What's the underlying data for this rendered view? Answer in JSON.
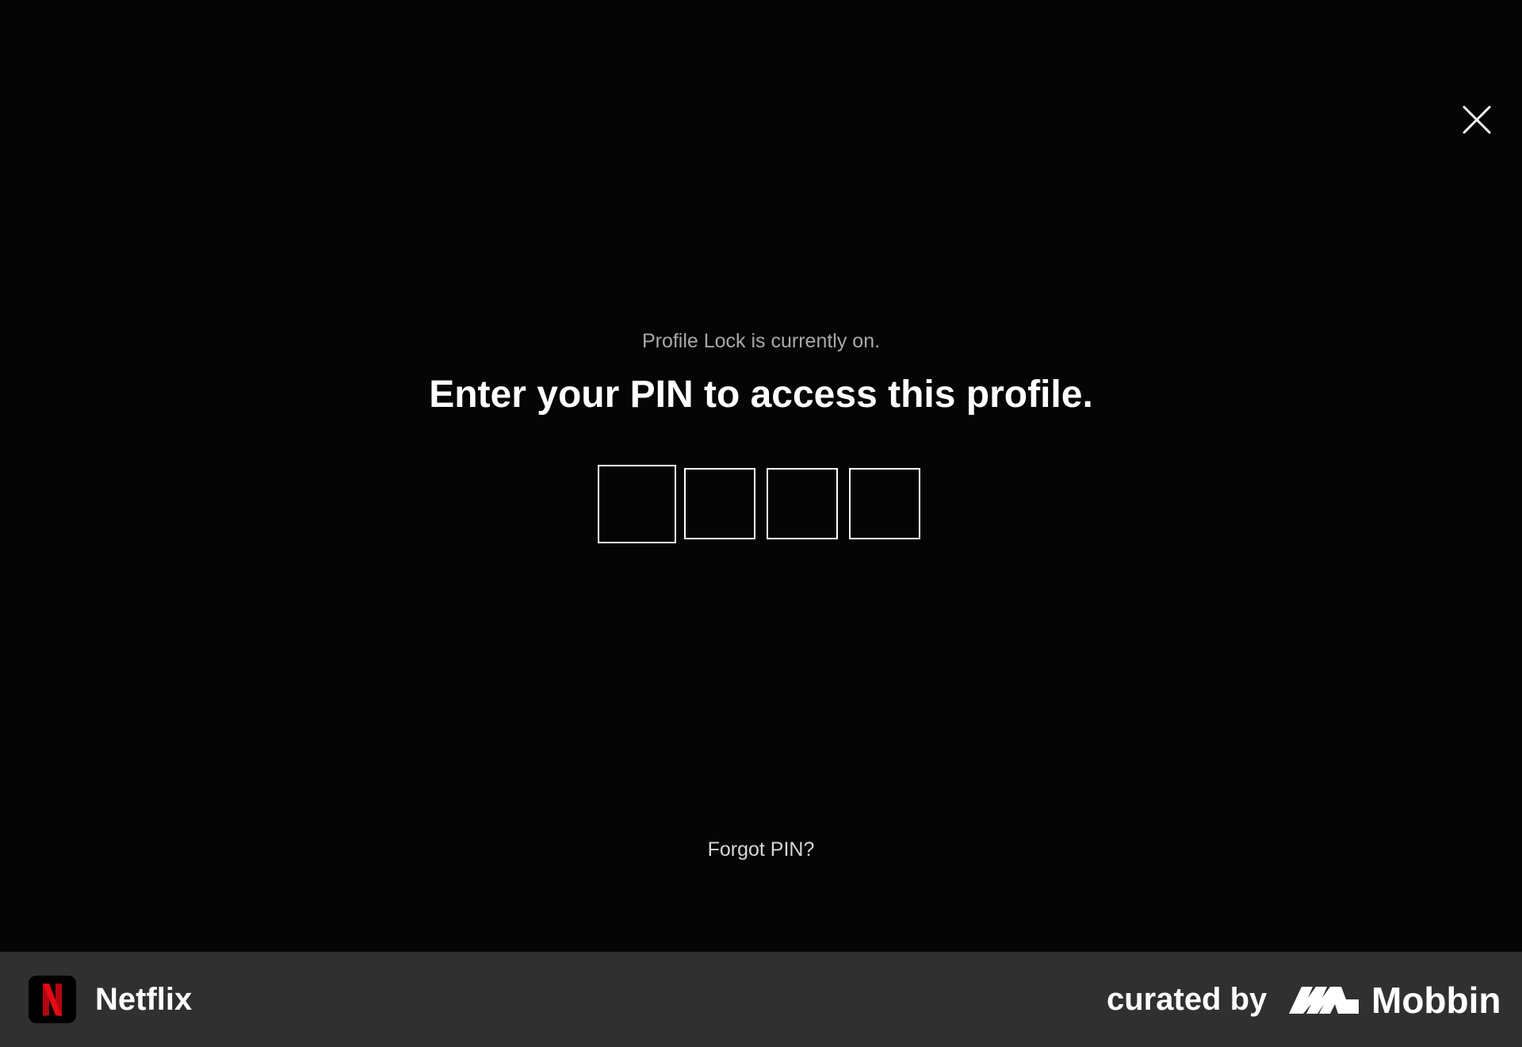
{
  "dialog": {
    "lock_status": "Profile Lock is currently on.",
    "headline": "Enter your PIN to access this profile.",
    "forgot_pin": "Forgot PIN?",
    "pin_boxes": [
      "",
      "",
      "",
      ""
    ],
    "close_icon": "close-icon"
  },
  "footer": {
    "app_name": "Netflix",
    "app_icon": "netflix-n-icon",
    "curated_by": "curated by",
    "brand_name": "Mobbin",
    "brand_logo": "mobbin-logo"
  },
  "colors": {
    "background": "#050505",
    "footer_background": "#303030",
    "netflix_red": "#E50914",
    "secondary_text": "#a8a8a8"
  }
}
